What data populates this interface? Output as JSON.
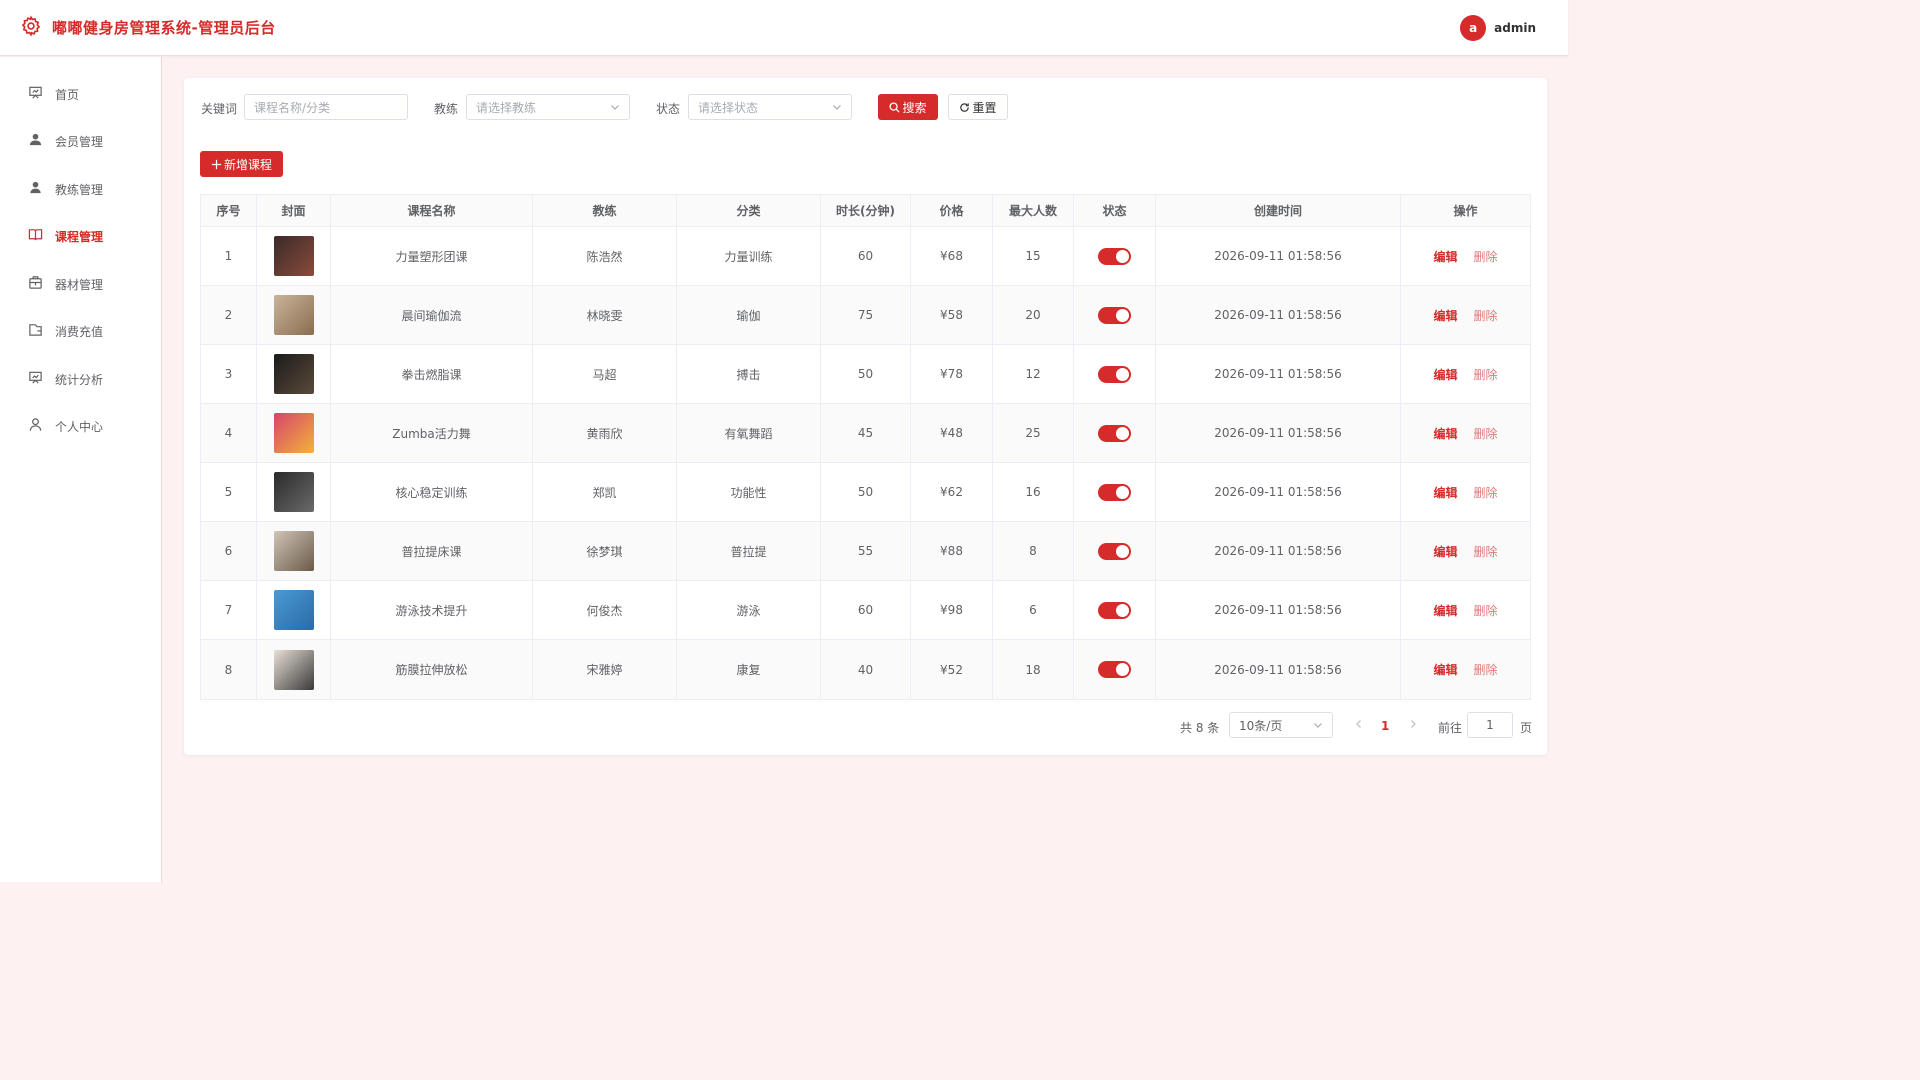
{
  "header": {
    "title": "嘟嘟健身房管理系统-管理员后台",
    "avatar_letter": "a",
    "username": "admin"
  },
  "sidebar": {
    "items": [
      {
        "label": "首页",
        "icon": "dashboard-icon"
      },
      {
        "label": "会员管理",
        "icon": "user-icon"
      },
      {
        "label": "教练管理",
        "icon": "coach-icon"
      },
      {
        "label": "课程管理",
        "icon": "book-icon",
        "active": true
      },
      {
        "label": "器材管理",
        "icon": "equipment-icon"
      },
      {
        "label": "消费充值",
        "icon": "wallet-icon"
      },
      {
        "label": "统计分析",
        "icon": "chart-icon"
      },
      {
        "label": "个人中心",
        "icon": "person-icon"
      }
    ]
  },
  "filters": {
    "keyword_label": "关键词",
    "keyword_placeholder": "课程名称/分类",
    "coach_label": "教练",
    "coach_placeholder": "请选择教练",
    "status_label": "状态",
    "status_placeholder": "请选择状态",
    "search_button": "搜索",
    "reset_button": "重置"
  },
  "toolbar": {
    "add_button": "新增课程"
  },
  "table": {
    "columns": [
      "序号",
      "封面",
      "课程名称",
      "教练",
      "分类",
      "时长(分钟)",
      "价格",
      "最大人数",
      "状态",
      "创建时间",
      "操作"
    ],
    "edit_label": "编辑",
    "delete_label": "删除",
    "rows": [
      {
        "no": "1",
        "name": "力量塑形团课",
        "coach": "陈浩然",
        "category": "力量训练",
        "duration": "60",
        "price": "¥68",
        "max": "15",
        "enabled": true,
        "created": "2026-09-11 01:58:56"
      },
      {
        "no": "2",
        "name": "晨间瑜伽流",
        "coach": "林晓雯",
        "category": "瑜伽",
        "duration": "75",
        "price": "¥58",
        "max": "20",
        "enabled": true,
        "created": "2026-09-11 01:58:56"
      },
      {
        "no": "3",
        "name": "拳击燃脂课",
        "coach": "马超",
        "category": "搏击",
        "duration": "50",
        "price": "¥78",
        "max": "12",
        "enabled": true,
        "created": "2026-09-11 01:58:56"
      },
      {
        "no": "4",
        "name": "Zumba活力舞",
        "coach": "黄雨欣",
        "category": "有氧舞蹈",
        "duration": "45",
        "price": "¥48",
        "max": "25",
        "enabled": true,
        "created": "2026-09-11 01:58:56"
      },
      {
        "no": "5",
        "name": "核心稳定训练",
        "coach": "郑凯",
        "category": "功能性",
        "duration": "50",
        "price": "¥62",
        "max": "16",
        "enabled": true,
        "created": "2026-09-11 01:58:56"
      },
      {
        "no": "6",
        "name": "普拉提床课",
        "coach": "徐梦琪",
        "category": "普拉提",
        "duration": "55",
        "price": "¥88",
        "max": "8",
        "enabled": true,
        "created": "2026-09-11 01:58:56"
      },
      {
        "no": "7",
        "name": "游泳技术提升",
        "coach": "何俊杰",
        "category": "游泳",
        "duration": "60",
        "price": "¥98",
        "max": "6",
        "enabled": true,
        "created": "2026-09-11 01:58:56"
      },
      {
        "no": "8",
        "name": "筋膜拉伸放松",
        "coach": "宋雅婷",
        "category": "康复",
        "duration": "40",
        "price": "¥52",
        "max": "18",
        "enabled": true,
        "created": "2026-09-11 01:58:56"
      }
    ]
  },
  "pagination": {
    "total_text": "共 8 条",
    "page_size": "10条/页",
    "current_page": "1",
    "goto_label": "前往",
    "goto_value": "1",
    "page_suffix": "页"
  },
  "colors": {
    "accent": "#d62b2b",
    "background": "#fdf1f1"
  }
}
